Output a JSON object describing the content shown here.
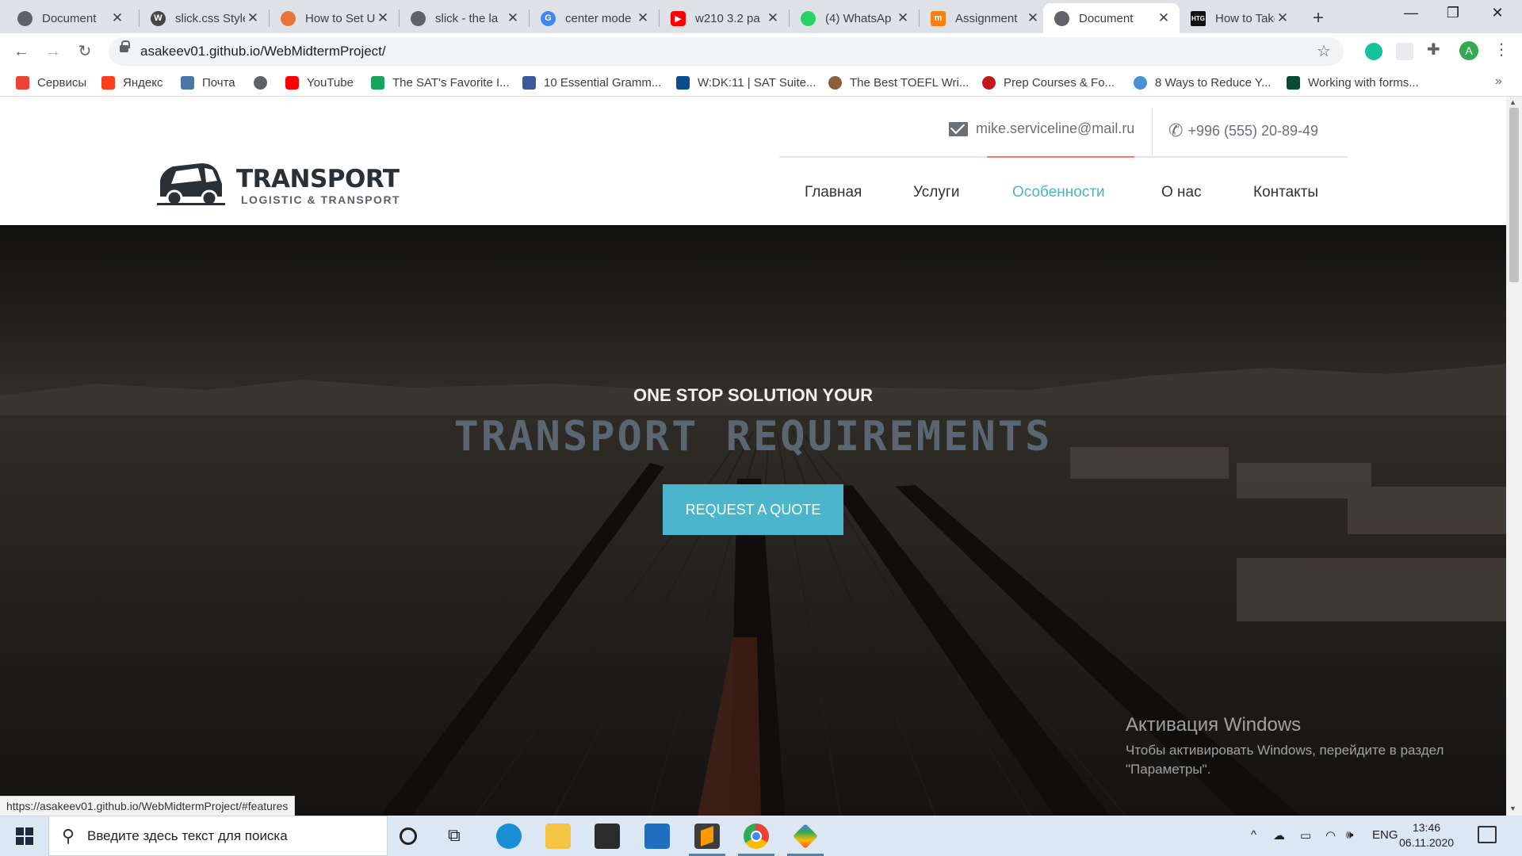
{
  "tabs": [
    {
      "title": "Document",
      "favicon": "globe-icon",
      "color": "#5f6368"
    },
    {
      "title": "slick.css Style",
      "favicon": "wordpress-icon",
      "color": "#464646"
    },
    {
      "title": "How to Set U",
      "favicon": "orange-site-icon",
      "color": "#e8743b"
    },
    {
      "title": "slick - the la",
      "favicon": "globe-icon",
      "color": "#5f6368"
    },
    {
      "title": "center mode",
      "favicon": "google-icon",
      "color": "#4285f4"
    },
    {
      "title": "w210 3.2 pa",
      "favicon": "youtube-icon",
      "color": "#ff0000"
    },
    {
      "title": "(4) WhatsAp",
      "favicon": "whatsapp-icon",
      "color": "#25d366"
    },
    {
      "title": "Assignment",
      "favicon": "moodle-icon",
      "color": "#f98012"
    },
    {
      "title": "Document",
      "favicon": "globe-icon",
      "color": "#5f6368",
      "active": true
    },
    {
      "title": "How to Take",
      "favicon": "htg-icon",
      "color": "#111111"
    }
  ],
  "browser": {
    "url": "asakeev01.github.io/WebMidtermProject/",
    "avatar_letter": "A",
    "status_url": "https://asakeev01.github.io/WebMidtermProject/#features"
  },
  "bookmarks": [
    {
      "label": "Сервисы",
      "color": "#ea4335"
    },
    {
      "label": "Яндекс",
      "color": "#fc3f1d"
    },
    {
      "label": "Почта",
      "color": "#4a76a8"
    },
    {
      "label": "",
      "color": "#5f6368"
    },
    {
      "label": "YouTube",
      "color": "#ff0000"
    },
    {
      "label": "The SAT's Favorite I...",
      "color": "#1aa260"
    },
    {
      "label": "10 Essential Gramm...",
      "color": "#3b5998"
    },
    {
      "label": "W:DK:11 | SAT Suite...",
      "color": "#0b4d8a"
    },
    {
      "label": "The Best TOEFL Wri...",
      "color": "#8b5e3c"
    },
    {
      "label": "Prep Courses & Fo...",
      "color": "#c4161c"
    },
    {
      "label": "8 Ways to Reduce Y...",
      "color": "#4a90d9"
    },
    {
      "label": "Working with forms...",
      "color": "#0c4b33"
    }
  ],
  "site": {
    "logo_title": "TRANSPORT",
    "logo_subtitle": "LOGISTIC & TRANSPORT",
    "email": "mike.serviceline@mail.ru",
    "phone": "+996 (555) 20-89-49",
    "nav": [
      "Главная",
      "Услуги",
      "Особенности",
      "О нас",
      "Контакты"
    ],
    "active_nav": "Особенности",
    "accent_color": "#49b4cb"
  },
  "hero": {
    "line1": "ONE STOP SOLUTION YOUR",
    "line2": "TRANSPORT REQUIREMENTS",
    "button": "REQUEST A QUOTE"
  },
  "watermark": {
    "title": "Активация Windows",
    "body": "Чтобы активировать Windows, перейдите в раздел \"Параметры\"."
  },
  "taskbar": {
    "search_placeholder": "Введите здесь текст для поиска",
    "language": "ENG",
    "time": "13:46",
    "date": "06.11.2020"
  }
}
